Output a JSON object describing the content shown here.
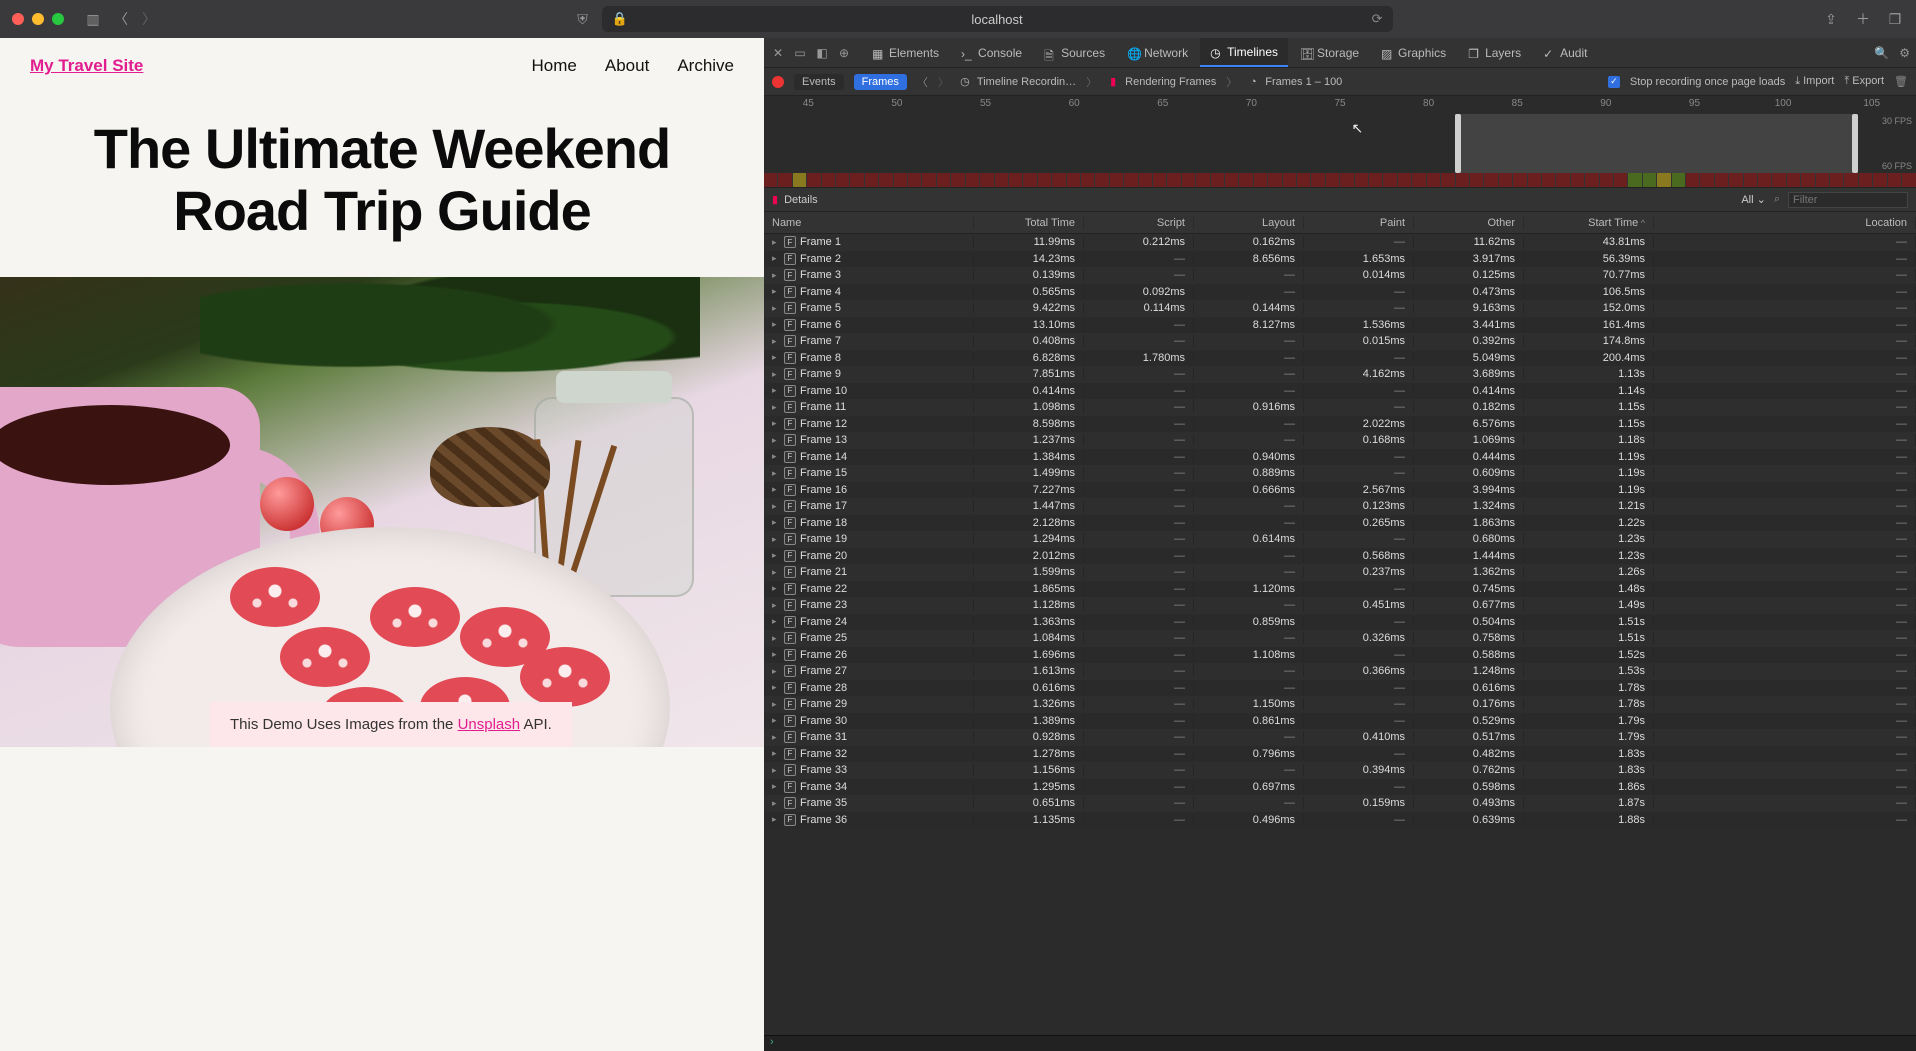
{
  "browser": {
    "address": "localhost"
  },
  "page": {
    "brand": "My Travel Site",
    "nav": {
      "home": "Home",
      "about": "About",
      "archive": "Archive"
    },
    "title": "The Ultimate Weekend Road Trip Guide",
    "caption_pre": "This Demo Uses Images from the ",
    "caption_link": "Unsplash",
    "caption_post": " API."
  },
  "devtools": {
    "tabs": {
      "elements": "Elements",
      "console": "Console",
      "sources": "Sources",
      "network": "Network",
      "timelines": "Timelines",
      "storage": "Storage",
      "graphics": "Graphics",
      "layers": "Layers",
      "audit": "Audit"
    },
    "subbar": {
      "events": "Events",
      "frames": "Frames",
      "recording": "Timeline Recordin…",
      "rendering": "Rendering Frames",
      "range": "Frames 1 – 100",
      "stop_label": "Stop recording once page loads",
      "import": "Import",
      "export": "Export"
    },
    "ruler": [
      "45",
      "50",
      "55",
      "60",
      "65",
      "70",
      "75",
      "80",
      "85",
      "90",
      "95",
      "100",
      "105"
    ],
    "fps": {
      "top": "30 FPS",
      "bot": "60 FPS"
    },
    "details_label": "Details",
    "filter_scope": "All",
    "filter_placeholder": "Filter",
    "columns": {
      "name": "Name",
      "total": "Total Time",
      "script": "Script",
      "layout": "Layout",
      "paint": "Paint",
      "other": "Other",
      "start": "Start Time",
      "location": "Location"
    },
    "rows": [
      {
        "n": "Frame 1",
        "t": "11.99ms",
        "s": "0.212ms",
        "l": "0.162ms",
        "p": "—",
        "o": "11.62ms",
        "st": "43.81ms",
        "loc": "—"
      },
      {
        "n": "Frame 2",
        "t": "14.23ms",
        "s": "—",
        "l": "8.656ms",
        "p": "1.653ms",
        "o": "3.917ms",
        "st": "56.39ms",
        "loc": "—"
      },
      {
        "n": "Frame 3",
        "t": "0.139ms",
        "s": "—",
        "l": "—",
        "p": "0.014ms",
        "o": "0.125ms",
        "st": "70.77ms",
        "loc": "—"
      },
      {
        "n": "Frame 4",
        "t": "0.565ms",
        "s": "0.092ms",
        "l": "—",
        "p": "—",
        "o": "0.473ms",
        "st": "106.5ms",
        "loc": "—"
      },
      {
        "n": "Frame 5",
        "t": "9.422ms",
        "s": "0.114ms",
        "l": "0.144ms",
        "p": "—",
        "o": "9.163ms",
        "st": "152.0ms",
        "loc": "—"
      },
      {
        "n": "Frame 6",
        "t": "13.10ms",
        "s": "—",
        "l": "8.127ms",
        "p": "1.536ms",
        "o": "3.441ms",
        "st": "161.4ms",
        "loc": "—"
      },
      {
        "n": "Frame 7",
        "t": "0.408ms",
        "s": "—",
        "l": "—",
        "p": "0.015ms",
        "o": "0.392ms",
        "st": "174.8ms",
        "loc": "—"
      },
      {
        "n": "Frame 8",
        "t": "6.828ms",
        "s": "1.780ms",
        "l": "—",
        "p": "—",
        "o": "5.049ms",
        "st": "200.4ms",
        "loc": "—"
      },
      {
        "n": "Frame 9",
        "t": "7.851ms",
        "s": "—",
        "l": "—",
        "p": "4.162ms",
        "o": "3.689ms",
        "st": "1.13s",
        "loc": "—"
      },
      {
        "n": "Frame 10",
        "t": "0.414ms",
        "s": "—",
        "l": "—",
        "p": "—",
        "o": "0.414ms",
        "st": "1.14s",
        "loc": "—"
      },
      {
        "n": "Frame 11",
        "t": "1.098ms",
        "s": "—",
        "l": "0.916ms",
        "p": "—",
        "o": "0.182ms",
        "st": "1.15s",
        "loc": "—"
      },
      {
        "n": "Frame 12",
        "t": "8.598ms",
        "s": "—",
        "l": "—",
        "p": "2.022ms",
        "o": "6.576ms",
        "st": "1.15s",
        "loc": "—"
      },
      {
        "n": "Frame 13",
        "t": "1.237ms",
        "s": "—",
        "l": "—",
        "p": "0.168ms",
        "o": "1.069ms",
        "st": "1.18s",
        "loc": "—"
      },
      {
        "n": "Frame 14",
        "t": "1.384ms",
        "s": "—",
        "l": "0.940ms",
        "p": "—",
        "o": "0.444ms",
        "st": "1.19s",
        "loc": "—"
      },
      {
        "n": "Frame 15",
        "t": "1.499ms",
        "s": "—",
        "l": "0.889ms",
        "p": "—",
        "o": "0.609ms",
        "st": "1.19s",
        "loc": "—"
      },
      {
        "n": "Frame 16",
        "t": "7.227ms",
        "s": "—",
        "l": "0.666ms",
        "p": "2.567ms",
        "o": "3.994ms",
        "st": "1.19s",
        "loc": "—"
      },
      {
        "n": "Frame 17",
        "t": "1.447ms",
        "s": "—",
        "l": "—",
        "p": "0.123ms",
        "o": "1.324ms",
        "st": "1.21s",
        "loc": "—"
      },
      {
        "n": "Frame 18",
        "t": "2.128ms",
        "s": "—",
        "l": "—",
        "p": "0.265ms",
        "o": "1.863ms",
        "st": "1.22s",
        "loc": "—"
      },
      {
        "n": "Frame 19",
        "t": "1.294ms",
        "s": "—",
        "l": "0.614ms",
        "p": "—",
        "o": "0.680ms",
        "st": "1.23s",
        "loc": "—"
      },
      {
        "n": "Frame 20",
        "t": "2.012ms",
        "s": "—",
        "l": "—",
        "p": "0.568ms",
        "o": "1.444ms",
        "st": "1.23s",
        "loc": "—"
      },
      {
        "n": "Frame 21",
        "t": "1.599ms",
        "s": "—",
        "l": "—",
        "p": "0.237ms",
        "o": "1.362ms",
        "st": "1.26s",
        "loc": "—"
      },
      {
        "n": "Frame 22",
        "t": "1.865ms",
        "s": "—",
        "l": "1.120ms",
        "p": "—",
        "o": "0.745ms",
        "st": "1.48s",
        "loc": "—"
      },
      {
        "n": "Frame 23",
        "t": "1.128ms",
        "s": "—",
        "l": "—",
        "p": "0.451ms",
        "o": "0.677ms",
        "st": "1.49s",
        "loc": "—"
      },
      {
        "n": "Frame 24",
        "t": "1.363ms",
        "s": "—",
        "l": "0.859ms",
        "p": "—",
        "o": "0.504ms",
        "st": "1.51s",
        "loc": "—"
      },
      {
        "n": "Frame 25",
        "t": "1.084ms",
        "s": "—",
        "l": "—",
        "p": "0.326ms",
        "o": "0.758ms",
        "st": "1.51s",
        "loc": "—"
      },
      {
        "n": "Frame 26",
        "t": "1.696ms",
        "s": "—",
        "l": "1.108ms",
        "p": "—",
        "o": "0.588ms",
        "st": "1.52s",
        "loc": "—"
      },
      {
        "n": "Frame 27",
        "t": "1.613ms",
        "s": "—",
        "l": "—",
        "p": "0.366ms",
        "o": "1.248ms",
        "st": "1.53s",
        "loc": "—"
      },
      {
        "n": "Frame 28",
        "t": "0.616ms",
        "s": "—",
        "l": "—",
        "p": "—",
        "o": "0.616ms",
        "st": "1.78s",
        "loc": "—"
      },
      {
        "n": "Frame 29",
        "t": "1.326ms",
        "s": "—",
        "l": "1.150ms",
        "p": "—",
        "o": "0.176ms",
        "st": "1.78s",
        "loc": "—"
      },
      {
        "n": "Frame 30",
        "t": "1.389ms",
        "s": "—",
        "l": "0.861ms",
        "p": "—",
        "o": "0.529ms",
        "st": "1.79s",
        "loc": "—"
      },
      {
        "n": "Frame 31",
        "t": "0.928ms",
        "s": "—",
        "l": "—",
        "p": "0.410ms",
        "o": "0.517ms",
        "st": "1.79s",
        "loc": "—"
      },
      {
        "n": "Frame 32",
        "t": "1.278ms",
        "s": "—",
        "l": "0.796ms",
        "p": "—",
        "o": "0.482ms",
        "st": "1.83s",
        "loc": "—"
      },
      {
        "n": "Frame 33",
        "t": "1.156ms",
        "s": "—",
        "l": "—",
        "p": "0.394ms",
        "o": "0.762ms",
        "st": "1.83s",
        "loc": "—"
      },
      {
        "n": "Frame 34",
        "t": "1.295ms",
        "s": "—",
        "l": "0.697ms",
        "p": "—",
        "o": "0.598ms",
        "st": "1.86s",
        "loc": "—"
      },
      {
        "n": "Frame 35",
        "t": "0.651ms",
        "s": "—",
        "l": "—",
        "p": "0.159ms",
        "o": "0.493ms",
        "st": "1.87s",
        "loc": "—"
      },
      {
        "n": "Frame 36",
        "t": "1.135ms",
        "s": "—",
        "l": "0.496ms",
        "p": "—",
        "o": "0.639ms",
        "st": "1.88s",
        "loc": "—"
      }
    ]
  }
}
